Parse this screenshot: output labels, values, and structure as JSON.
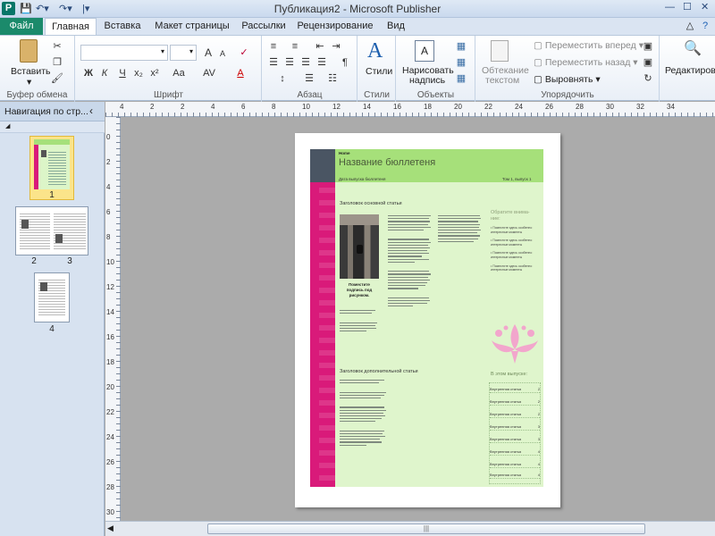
{
  "app": {
    "window_title": "Публикация2 - Microsoft Publisher",
    "app_icon": "P"
  },
  "tabs": [
    {
      "label": "Файл"
    },
    {
      "label": "Главная"
    },
    {
      "label": "Вставка"
    },
    {
      "label": "Макет страницы"
    },
    {
      "label": "Рассылки"
    },
    {
      "label": "Рецензирование"
    },
    {
      "label": "Вид"
    }
  ],
  "ribbon": {
    "clipboard": {
      "group": "Буфер обмена",
      "paste": "Вставить"
    },
    "font": {
      "group": "Шрифт",
      "bold": "Ж",
      "italic": "К",
      "underline": "Ч",
      "subscript": "x₂",
      "superscript": "x²",
      "case": "Aa",
      "grow": "A",
      "shrink": "A"
    },
    "paragraph": {
      "group": "Абзац",
      "pilcrow": "¶"
    },
    "styles": {
      "group": "Стили",
      "styles": "Стили"
    },
    "objects": {
      "group": "Объекты",
      "draw_textbox_line1": "Нарисовать",
      "draw_textbox_line2": "надпись"
    },
    "arrange": {
      "group": "Упорядочить",
      "wrap_line1": "Обтекание",
      "wrap_line2": "текстом",
      "bring_forward": "Переместить вперед",
      "send_backward": "Переместить назад",
      "align": "Выровнять"
    },
    "editing": {
      "label": "Редактирова"
    }
  },
  "nav": {
    "title": "Навигация по стр...",
    "pages": [
      "1",
      "2",
      "3",
      "4"
    ]
  },
  "rulers": {
    "h": [
      "4",
      "2",
      "2",
      "4",
      "6",
      "8",
      "10",
      "12",
      "14",
      "16",
      "18",
      "20",
      "22",
      "24",
      "26",
      "28",
      "30",
      "32",
      "34"
    ],
    "v": [
      "0",
      "2",
      "4",
      "6",
      "8",
      "10",
      "12",
      "14",
      "16",
      "18",
      "20",
      "22",
      "24",
      "26",
      "28",
      "30"
    ]
  },
  "publication": {
    "home_label": "Home",
    "newsletter_title": "Название бюллетеня",
    "issue_date": "Дата выпуска бюллетеня",
    "volume": "Том 1, выпуск 1",
    "main_heading": "Заголовок основной статьи",
    "photo_caption": "Поместите подпись под рисунком.",
    "secondary_heading": "Заголовок дополнительной статьи",
    "sidebar_heading": "Обратите внима- ние:",
    "bullets": [
      "Поместите здесь особенно интересные моменты",
      "Поместите здесь особенно интересные моменты",
      "Поместите здесь особенно интересные моменты",
      "Поместите здесь особенно интересные моменты"
    ],
    "toc_heading": "В этом выпуске:",
    "toc_items": [
      {
        "title": "Внутренняя статья",
        "page": "2"
      },
      {
        "title": "Внутренняя статья",
        "page": "2"
      },
      {
        "title": "Внутренняя статья",
        "page": "2"
      },
      {
        "title": "Внутренняя статья",
        "page": "3"
      },
      {
        "title": "Внутренняя статья",
        "page": "3"
      },
      {
        "title": "Внутренняя статья",
        "page": "4"
      },
      {
        "title": "Внутренняя статья",
        "page": "4"
      },
      {
        "title": "Внутренняя статья",
        "page": "4"
      }
    ]
  },
  "colors": {
    "accent_magenta": "#d91a7a",
    "header_green": "#a6e07a",
    "page_green": "#dff5cc",
    "slate": "#4a5563",
    "file_tab": "#1b8a6b"
  }
}
